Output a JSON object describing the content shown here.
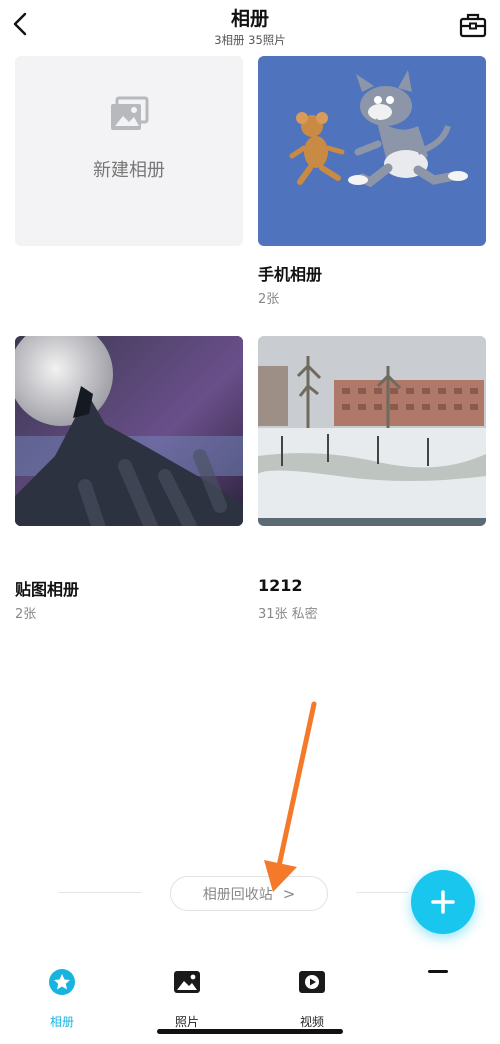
{
  "header": {
    "title": "相册",
    "subtitle": "3相册  35照片"
  },
  "new_album": {
    "label": "新建相册"
  },
  "albums": [
    {
      "name": "手机相册",
      "meta": "2张"
    },
    {
      "name": "贴图相册",
      "meta": "2张"
    },
    {
      "name": "1212",
      "meta": "31张  私密"
    }
  ],
  "recycle": {
    "label": "相册回收站",
    "chevron": ">"
  },
  "tabs": [
    {
      "label": "相册",
      "icon": "album-icon",
      "active": true
    },
    {
      "label": "照片",
      "icon": "photo-icon",
      "active": false
    },
    {
      "label": "视频",
      "icon": "video-icon",
      "active": false
    }
  ],
  "colors": {
    "accent": "#18c6ee",
    "annotation_arrow": "#f47a2a"
  }
}
